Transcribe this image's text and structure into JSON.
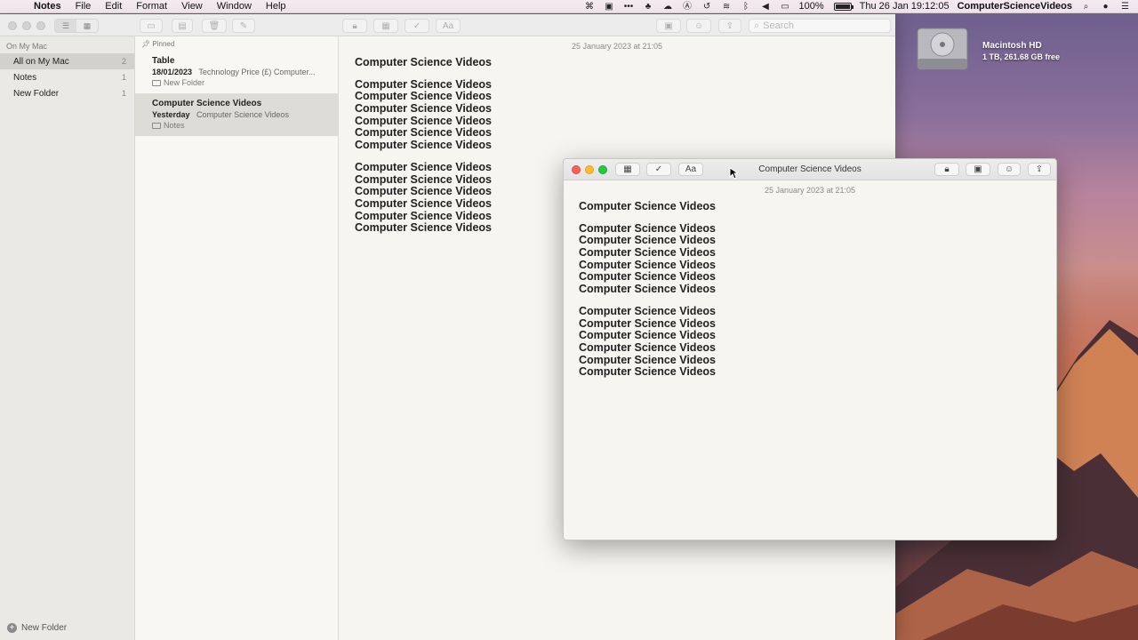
{
  "menubar": {
    "app": "Notes",
    "items": [
      "File",
      "Edit",
      "Format",
      "View",
      "Window",
      "Help"
    ],
    "battery": "100%",
    "clock": "Thu 26 Jan  19:12:05",
    "user": "ComputerScienceVideos"
  },
  "desktop": {
    "disk_name": "Macintosh HD",
    "disk_info": "1 TB, 261.68 GB free"
  },
  "main_window": {
    "search_placeholder": "Search",
    "sidebar": {
      "section": "On My Mac",
      "items": [
        {
          "label": "All on My Mac",
          "count": "2"
        },
        {
          "label": "Notes",
          "count": "1"
        },
        {
          "label": "New Folder",
          "count": "1"
        }
      ],
      "footer": "New Folder"
    },
    "notelist": {
      "pinned_label": "Pinned",
      "notes": [
        {
          "title": "Table",
          "date": "18/01/2023",
          "preview": "Technology Price (£) Computer...",
          "folder": "New Folder"
        },
        {
          "title": "Computer Science Videos",
          "date": "Yesterday",
          "preview": "Computer Science Videos",
          "folder": "Notes"
        }
      ]
    },
    "editor": {
      "date": "25 January 2023 at 21:05",
      "title_line": "Computer Science Videos",
      "line": "Computer Science Videos"
    }
  },
  "float_window": {
    "title": "Computer Science Videos",
    "format_button": "Aa",
    "date": "25 January 2023 at 21:05",
    "title_line": "Computer Science Videos",
    "line": "Computer Science Videos"
  }
}
